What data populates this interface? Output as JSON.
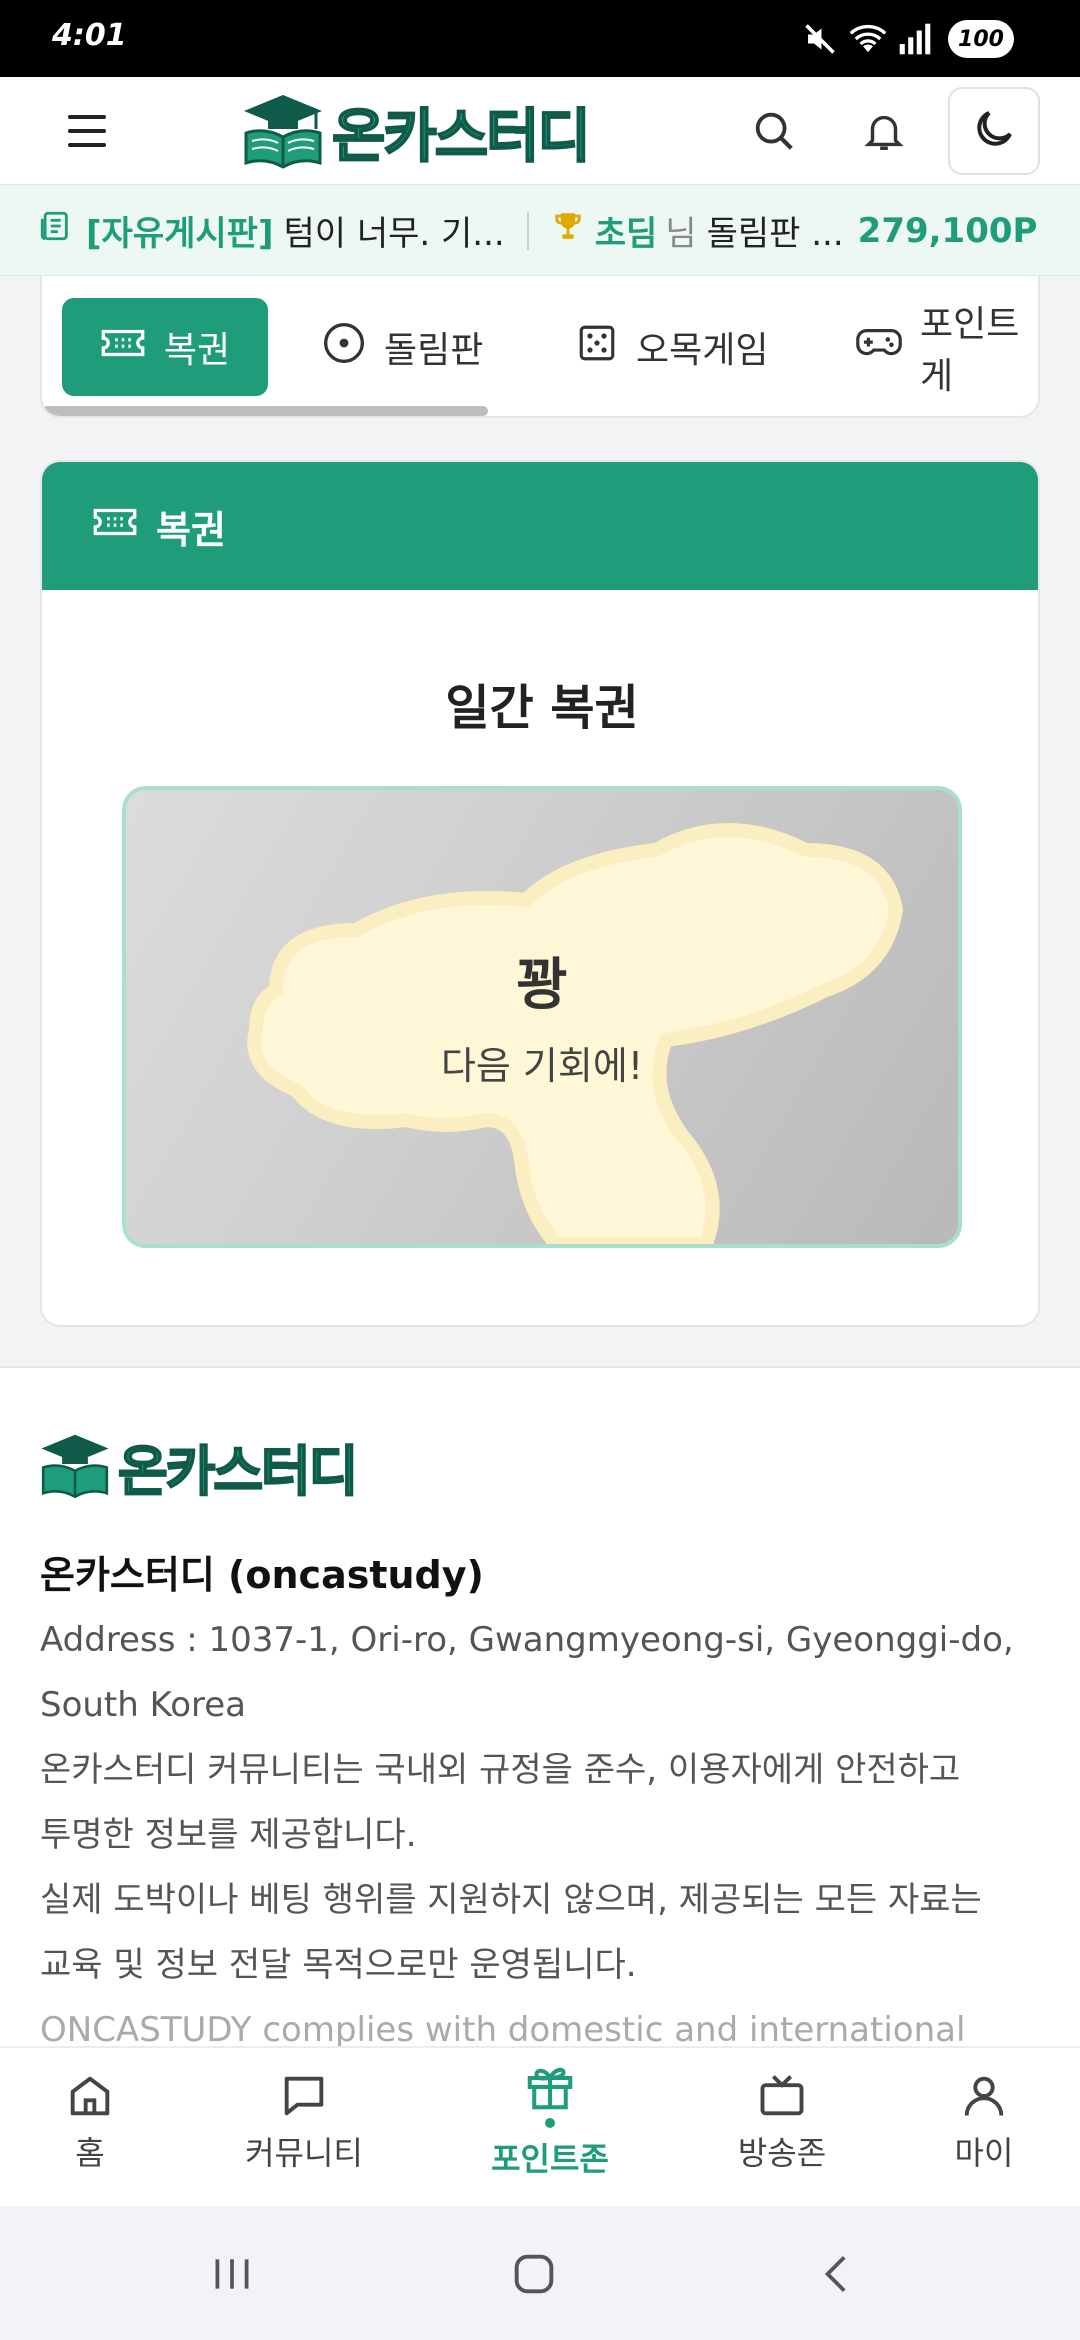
{
  "status_bar": {
    "time": "4:01",
    "battery": "100"
  },
  "header": {
    "logo_text": "온카스터디",
    "icons": [
      "hamburger-icon",
      "search-icon",
      "bell-icon",
      "moon-icon"
    ]
  },
  "ticker": {
    "board_tag": "[자유게시판]",
    "board_text": "텀이 너무. 기...",
    "rank": "초딤",
    "nim": "님",
    "event_text": "돌림판 ...",
    "points": "279,100P"
  },
  "tabs": [
    {
      "label": "복권",
      "icon": "ticket-icon",
      "active": true
    },
    {
      "label": "돌림판",
      "icon": "roulette-icon",
      "active": false
    },
    {
      "label": "오목게임",
      "icon": "dice-icon",
      "active": false
    },
    {
      "label": "포인트 게",
      "icon": "gamepad-icon",
      "active": false
    }
  ],
  "lottery": {
    "header_label": "복권",
    "title": "일간 복권",
    "result_main": "꽝",
    "result_sub": "다음 기회에!"
  },
  "footer": {
    "logo_text": "온카스터디",
    "name": "온카스터디 (oncastudy)",
    "lines": [
      "Address : 1037-1, Ori-ro, Gwangmyeong-si, Gyeonggi-do,",
      "South Korea",
      "온카스터디 커뮤니티는 국내외 규정을 준수, 이용자에게 안전하고",
      "투명한 정보를 제공합니다.",
      "실제 도박이나 베팅 행위를 지원하지 않으며, 제공되는 모든 자료는",
      "교육 및 정보 전달 목적으로만 운영됩니다."
    ],
    "faded_line": "ONCASTUDY complies with domestic and international"
  },
  "bottom_nav": [
    {
      "label": "홈",
      "icon": "home-icon",
      "active": false
    },
    {
      "label": "커뮤니티",
      "icon": "chat-icon",
      "active": false
    },
    {
      "label": "포인트존",
      "icon": "gift-icon",
      "active": true
    },
    {
      "label": "방송존",
      "icon": "tv-icon",
      "active": false
    },
    {
      "label": "마이",
      "icon": "user-icon",
      "active": false
    }
  ],
  "colors": {
    "brand": "#1f9c79",
    "brand_dark": "#0f5a48"
  }
}
